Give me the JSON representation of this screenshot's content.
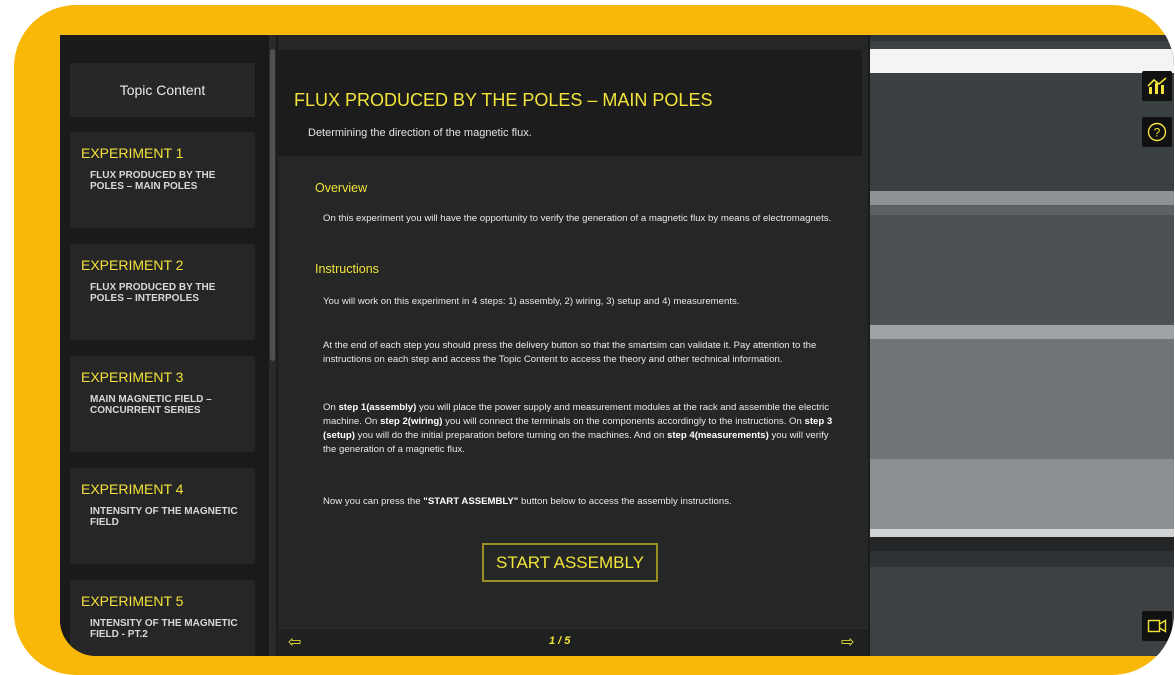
{
  "sidebar": {
    "topic_content_label": "Topic Content",
    "experiments": [
      {
        "title": "EXPERIMENT 1",
        "subtitle": "FLUX PRODUCED BY THE POLES – MAIN POLES"
      },
      {
        "title": "EXPERIMENT 2",
        "subtitle": "FLUX PRODUCED BY THE POLES – INTERPOLES"
      },
      {
        "title": "EXPERIMENT 3",
        "subtitle": "MAIN MAGNETIC FIELD – CONCURRENT SERIES"
      },
      {
        "title": "EXPERIMENT 4",
        "subtitle": "INTENSITY OF THE MAGNETIC FIELD"
      },
      {
        "title": "EXPERIMENT 5",
        "subtitle": "INTENSITY OF THE MAGNETIC FIELD - PT.2"
      }
    ]
  },
  "panel": {
    "title": "FLUX PRODUCED BY THE POLES – MAIN POLES",
    "subtitle": "Determining the direction of the magnetic flux.",
    "overview_heading": "Overview",
    "overview_text": "On this experiment you will have the opportunity to verify the generation of a magnetic flux by means of electromagnets.",
    "instructions_heading": "Instructions",
    "p1": "You will work on this experiment in 4 steps: 1) assembly, 2) wiring, 3) setup and 4) measurements.",
    "p2": "At the end of each step you should press the delivery button so that the smartsim can validate it. Pay attention to the instructions on each step and access the Topic Content to access the theory and other technical information.",
    "p3": {
      "t1": "On ",
      "b1": "step 1(assembly)",
      "t2": " you will place the power supply and measurement modules at the rack and assemble the electric machine. On ",
      "b2": "step 2(wiring)",
      "t3": " you will connect the terminals on the components accordingly to the instructions. On ",
      "b3": "step 3 (setup)",
      "t4": " you will do the initial preparation before turning on the machines. And on ",
      "b4": "step 4(measurements)",
      "t5": " you will verify the generation of a magnetic flux."
    },
    "p4": {
      "t1": "Now you can press the ",
      "b1": "\"START ASSEMBLY\"",
      "t2": " button below  to access the assembly instructions."
    },
    "start_button": "START ASSEMBLY",
    "pager": "1 / 5"
  },
  "colors": {
    "accent": "#f2e43a",
    "frame": "#f9b708"
  },
  "icons": {
    "prev": "arrow-left-icon",
    "next": "arrow-right-icon",
    "chart": "chart-icon",
    "help": "help-circle-icon",
    "camera": "video-camera-icon"
  }
}
